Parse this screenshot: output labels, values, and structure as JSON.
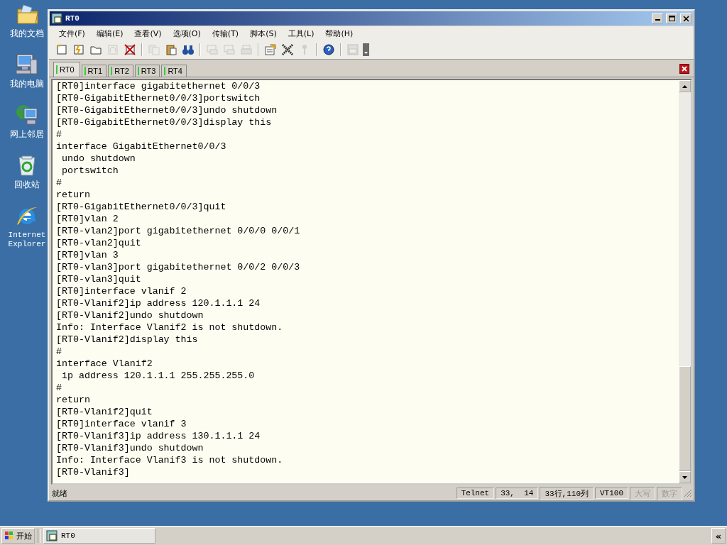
{
  "desktop_icons": [
    {
      "label": "我的文档",
      "kind": "folder"
    },
    {
      "label": "我的电脑",
      "kind": "computer"
    },
    {
      "label": "网上邻居",
      "kind": "network"
    },
    {
      "label": "回收站",
      "kind": "bin"
    },
    {
      "label": "Internet Explorer",
      "kind": "browser"
    }
  ],
  "window": {
    "title": "RT0"
  },
  "menu": [
    "文件(F)",
    "编辑(E)",
    "查看(V)",
    "选项(O)",
    "传输(T)",
    "脚本(S)",
    "工具(L)",
    "帮助(H)"
  ],
  "toolbar": [
    {
      "disabled": false
    },
    {
      "disabled": false
    },
    {
      "disabled": false
    },
    {
      "disabled": true
    },
    {
      "disabled": false
    },
    {
      "disabled": true
    },
    {
      "disabled": false
    },
    {
      "disabled": false
    },
    {
      "disabled": true
    },
    {
      "disabled": true
    },
    {
      "disabled": true
    },
    {
      "disabled": false
    },
    {
      "disabled": false
    },
    {
      "disabled": true
    },
    {
      "disabled": false
    },
    {
      "disabled": true
    }
  ],
  "tabs": [
    {
      "label": "RT0",
      "selected": true,
      "connected": true
    },
    {
      "label": "RT1",
      "selected": false,
      "connected": true
    },
    {
      "label": "RT2",
      "selected": false,
      "connected": true
    },
    {
      "label": "RT3",
      "selected": false,
      "connected": true
    },
    {
      "label": "RT4",
      "selected": false,
      "connected": true
    }
  ],
  "terminal": {
    "lines": [
      "[RT0]interface gigabitethernet 0/0/3",
      "[RT0-GigabitEthernet0/0/3]portswitch",
      "[RT0-GigabitEthernet0/0/3]undo shutdown",
      "[RT0-GigabitEthernet0/0/3]display this",
      "#",
      "interface GigabitEthernet0/0/3",
      " undo shutdown",
      " portswitch",
      "#",
      "return",
      "[RT0-GigabitEthernet0/0/3]quit",
      "[RT0]vlan 2",
      "[RT0-vlan2]port gigabitethernet 0/0/0 0/0/1",
      "[RT0-vlan2]quit",
      "[RT0]vlan 3",
      "[RT0-vlan3]port gigabitethernet 0/0/2 0/0/3",
      "[RT0-vlan3]quit",
      "[RT0]interface vlanif 2",
      "[RT0-Vlanif2]ip address 120.1.1.1 24",
      "[RT0-Vlanif2]undo shutdown",
      "Info: Interface Vlanif2 is not shutdown.",
      "[RT0-Vlanif2]display this",
      "#",
      "interface Vlanif2",
      " ip address 120.1.1.1 255.255.255.0",
      "#",
      "return",
      "[RT0-Vlanif2]quit",
      "[RT0]interface vlanif 3",
      "[RT0-Vlanif3]ip address 130.1.1.1 24",
      "[RT0-Vlanif3]undo shutdown",
      "Info: Interface Vlanif3 is not shutdown.",
      "[RT0-Vlanif3]"
    ]
  },
  "status_bar": {
    "message": "就绪",
    "fields": [
      {
        "text": "Telnet",
        "disabled": false
      },
      {
        "text": "33,  14",
        "disabled": false
      },
      {
        "text": "33行,110列",
        "disabled": false
      },
      {
        "text": "VT100",
        "disabled": false
      },
      {
        "text": "大写",
        "disabled": true
      },
      {
        "text": "数字",
        "disabled": true
      }
    ]
  },
  "taskbar": {
    "start": "开始",
    "tasks": [
      {
        "label": "RT0",
        "selected": false
      }
    ],
    "expand": "«"
  }
}
